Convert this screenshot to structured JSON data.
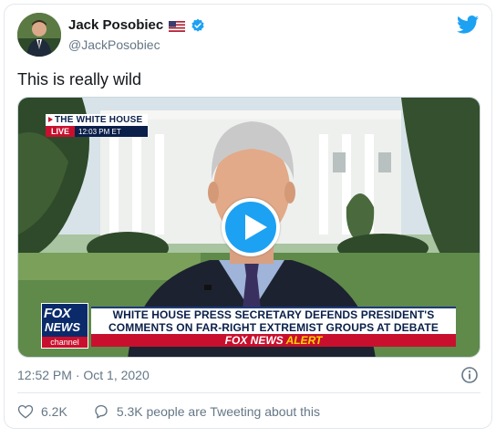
{
  "user": {
    "display_name": "Jack Posobiec",
    "handle": "@JackPosobiec",
    "flag_icon": "us-flag-icon",
    "verified_icon": "verified-badge-icon"
  },
  "brand_icon": "twitter-bird-icon",
  "tweet": {
    "text": "This is really wild"
  },
  "video": {
    "location_label": "THE WHITE HOUSE",
    "live_label": "LIVE",
    "live_time": "12:03 PM ET",
    "network_logo": {
      "fox": "FOX",
      "news": "NEWS",
      "channel": "channel"
    },
    "headline_line1": "WHITE HOUSE PRESS SECRETARY DEFENDS PRESIDENT'S",
    "headline_line2": "COMMENTS ON FAR-RIGHT EXTREMIST GROUPS AT DEBATE",
    "alert_prefix": "FOX NEWS",
    "alert_word": "ALERT",
    "play_icon": "play-icon"
  },
  "meta": {
    "timestamp": "12:52 PM · Oct 1, 2020",
    "info_icon": "info-icon"
  },
  "actions": {
    "likes": "6.2K",
    "conversation": "5.3K people are Tweeting about this"
  },
  "colors": {
    "twitter_blue": "#1da1f2",
    "text_primary": "#14171a",
    "text_secondary": "#657786",
    "fox_red": "#c8102e",
    "fox_navy": "#0a1f4a",
    "alert_yellow": "#ffd200"
  }
}
